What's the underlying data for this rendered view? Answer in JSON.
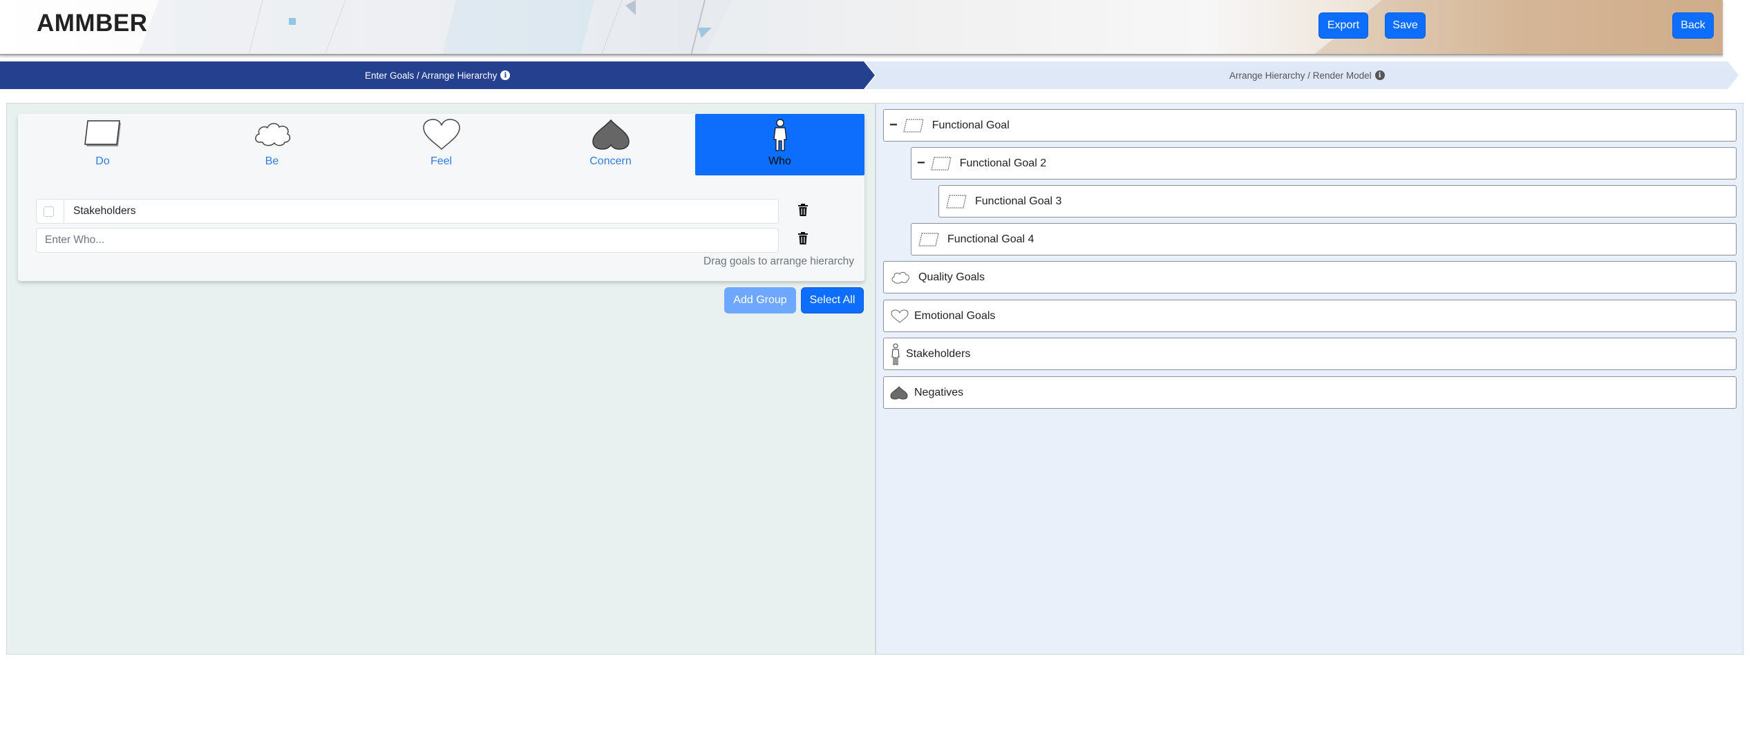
{
  "header": {
    "brand": "AMMBER",
    "export_label": "Export",
    "save_label": "Save",
    "back_label": "Back"
  },
  "stepper": {
    "steps": [
      {
        "label": "Enter Goals / Arrange Hierarchy",
        "active": true
      },
      {
        "label": "Arrange Hierarchy / Render Model",
        "active": false
      }
    ],
    "active_color": "#24408e",
    "inactive_color": "#dfe8f7"
  },
  "goal_tabs": [
    {
      "label": "Do",
      "icon": "parallelogram-icon"
    },
    {
      "label": "Be",
      "icon": "cloud-icon"
    },
    {
      "label": "Feel",
      "icon": "heart-icon"
    },
    {
      "label": "Concern",
      "icon": "spade-icon"
    },
    {
      "label": "Who",
      "icon": "person-icon",
      "active": true
    }
  ],
  "entries": {
    "items": [
      {
        "label": "Stakeholders"
      }
    ],
    "new_placeholder": "Enter Who...",
    "hint": "Drag goals to arrange hierarchy"
  },
  "actions": {
    "add_group": "Add Group",
    "select_all": "Select All"
  },
  "tree": [
    {
      "label": "Functional Goal",
      "icon": "parallelogram-icon",
      "collapsible": true
    },
    {
      "label": "Functional Goal 2",
      "icon": "parallelogram-icon",
      "collapsible": true
    },
    {
      "label": "Functional Goal 3",
      "icon": "parallelogram-icon",
      "collapsible": false
    },
    {
      "label": "Functional Goal 4",
      "icon": "parallelogram-icon",
      "collapsible": false
    },
    {
      "label": "Quality Goals",
      "icon": "cloud-icon",
      "collapsible": false
    },
    {
      "label": "Emotional Goals",
      "icon": "heart-icon",
      "collapsible": false
    },
    {
      "label": "Stakeholders",
      "icon": "person-icon",
      "collapsible": false
    },
    {
      "label": "Negatives",
      "icon": "spade-icon",
      "collapsible": false
    }
  ],
  "colors": {
    "primary": "#0d6efd",
    "primary_light": "#6ea8fe",
    "left_panel_bg": "#e8f1ef",
    "right_panel_bg": "#e9f0fa"
  }
}
